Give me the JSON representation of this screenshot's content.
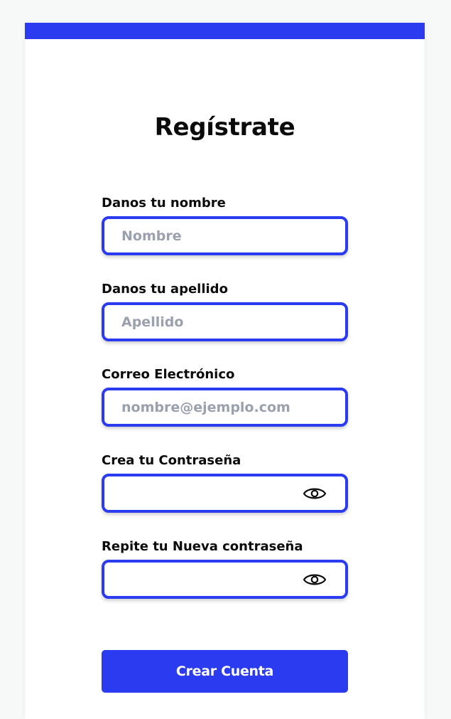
{
  "page": {
    "title": "Regístrate"
  },
  "form": {
    "fields": [
      {
        "label": "Danos tu nombre",
        "placeholder": "Nombre",
        "value": ""
      },
      {
        "label": "Danos tu apellido",
        "placeholder": "Apellido",
        "value": ""
      },
      {
        "label": "Correo Electrónico",
        "placeholder": "nombre@ejemplo.com",
        "value": ""
      },
      {
        "label": "Crea tu Contraseña",
        "placeholder": "",
        "value": "",
        "icon": "eye-icon"
      },
      {
        "label": "Repite tu Nueva contraseña",
        "placeholder": "",
        "value": "",
        "icon": "eye-icon"
      }
    ],
    "submit_label": "Crear Cuenta"
  },
  "colors": {
    "accent": "#2b3bef",
    "background": "#f7f8f8",
    "card": "#ffffff",
    "placeholder": "#9aa0ad",
    "text": "#0b0b0b"
  }
}
